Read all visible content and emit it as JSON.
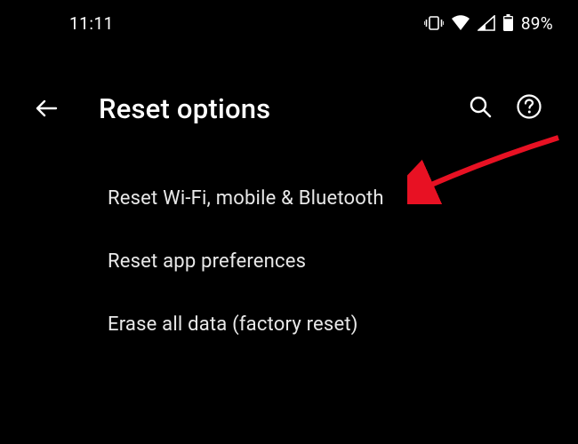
{
  "status_bar": {
    "time": "11:11",
    "battery": "89%"
  },
  "header": {
    "title": "Reset options"
  },
  "options": [
    {
      "label": "Reset Wi-Fi, mobile & Bluetooth"
    },
    {
      "label": "Reset app preferences"
    },
    {
      "label": "Erase all data (factory reset)"
    }
  ]
}
